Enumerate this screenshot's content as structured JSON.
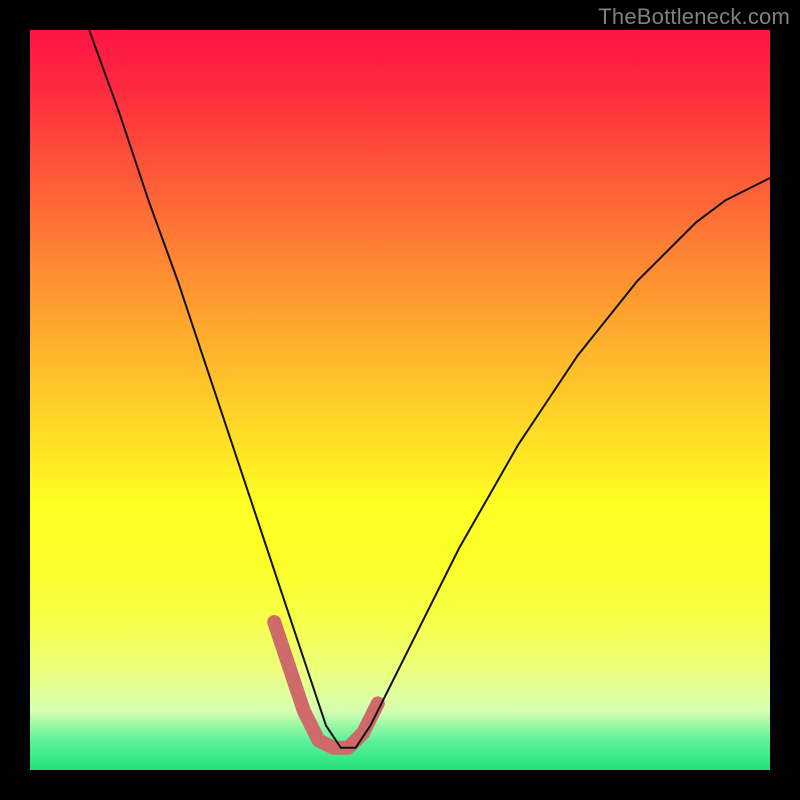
{
  "watermark": "TheBottleneck.com",
  "chart_data": {
    "type": "line",
    "title": "",
    "xlabel": "",
    "ylabel": "",
    "xlim": [
      0,
      100
    ],
    "ylim": [
      0,
      100
    ],
    "grid": false,
    "curve": {
      "x": [
        8,
        12,
        16,
        20,
        24,
        28,
        30,
        32,
        34,
        36,
        38,
        40,
        42,
        44,
        46,
        50,
        54,
        58,
        62,
        66,
        70,
        74,
        78,
        82,
        86,
        90,
        94,
        98,
        100
      ],
      "y": [
        100,
        89,
        77,
        66,
        54,
        42,
        36,
        30,
        24,
        18,
        12,
        6,
        3,
        3,
        6,
        14,
        22,
        30,
        37,
        44,
        50,
        56,
        61,
        66,
        70,
        74,
        77,
        79,
        80
      ]
    },
    "highlight_segment": {
      "x_start": 33,
      "x_end": 47,
      "x": [
        33,
        35,
        37,
        39,
        41,
        43,
        45,
        47
      ],
      "y": [
        20,
        14,
        8,
        4,
        3,
        3,
        5,
        9
      ]
    },
    "background_gradient": {
      "direction": "top-to-bottom",
      "stops": [
        {
          "pos": 0.0,
          "color": "#ff1445"
        },
        {
          "pos": 0.5,
          "color": "#ffd126"
        },
        {
          "pos": 0.8,
          "color": "#f6ff4a"
        },
        {
          "pos": 0.96,
          "color": "#5ef19a"
        },
        {
          "pos": 1.0,
          "color": "#22e27a"
        }
      ]
    }
  }
}
